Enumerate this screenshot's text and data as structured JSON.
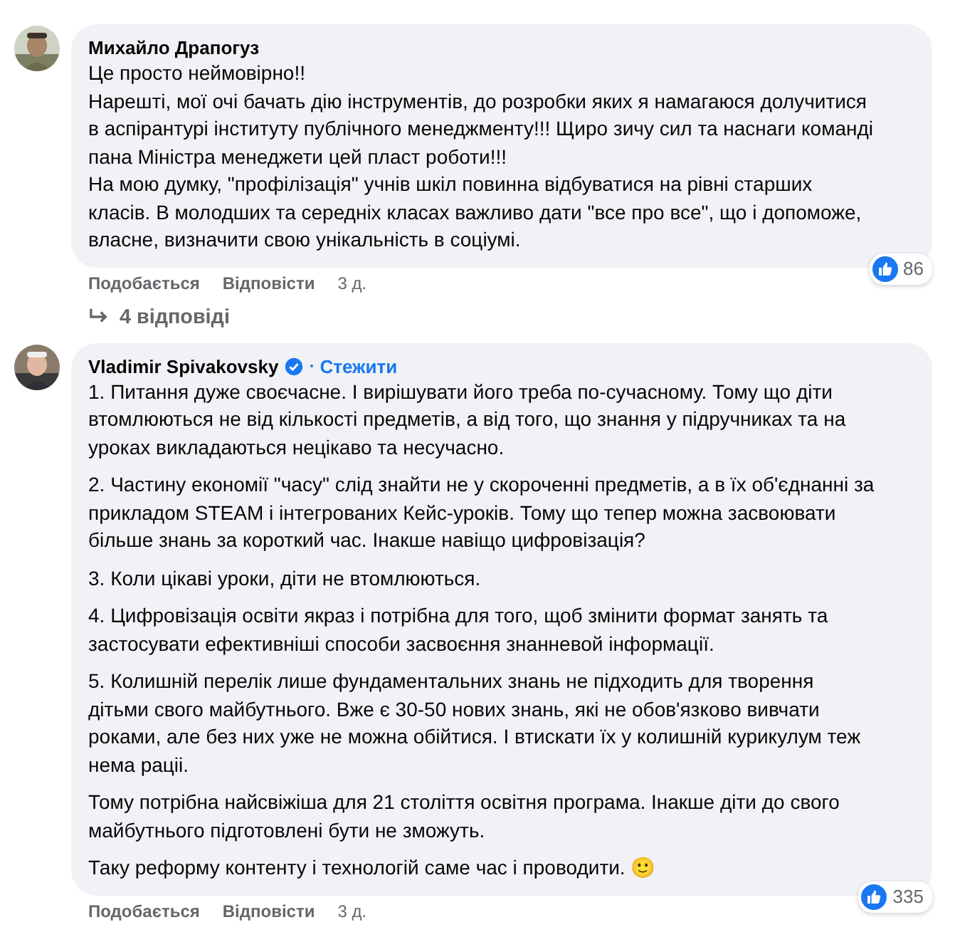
{
  "comments": [
    {
      "author": "Михайло Драпогуз",
      "verified": false,
      "spaced": false,
      "paragraphs": [
        "Це просто неймовірно!!",
        "Нарешті, мої очі бачать дію інструментів, до розробки яких я намагаюся долучитися в аспірантурі інституту публічного менеджменту!!! Щиро зичу сил та наснаги команді пана Міністра менеджети цей пласт роботи!!!",
        "На мою думку, \"профілізація\" учнів шкіл повинна відбуватися на рівні старших класів. В молодших та середніх класах важливо дати \"все про все\", що і допоможе, власне, визначити свою унікальність в соціумі."
      ],
      "reactions": "86",
      "actions": [
        "Подобається",
        "Відповісти"
      ],
      "time": "3 д.",
      "replies": "4 відповіді"
    },
    {
      "author": "Vladimir Spivakovsky",
      "verified": true,
      "follow": "Стежити",
      "spaced": true,
      "paragraphs": [
        "1. Питання дуже своєчасне. І вирішувати його треба по-сучасному. Тому що діти втомлюються не від кількості предметів, а від того, що знання у підручниках та на уроках викладаються нецікаво та несучасно.",
        "2. Частину економії \"часу\" слід знайти не у скороченні предметів, а в їх об'єднанні за прикладом STEAM і інтегрованих Кейс-уроків. Тому що тепер можна засвоювати більше знань за короткий час. Інакше навіщо цифровізація?",
        "3. Коли цікаві уроки, діти не втомлюються.",
        "4. Цифровізація освіти якраз і потрібна для того, щоб змінити формат занять та застосувати ефективніші способи засвоєння знанневой інформації.",
        "5. Колишній перелік лише фундаментальних знань не підходить для творення дітьми свого майбутнього. Вже є 30-50 нових знань, які не обов'язково вивчати роками, але без них уже не можна обійтися. І втискати їх у колишній курикулум теж нема раціі.",
        "Тому потрібна найсвіжіша для 21 століття освітня програма. Інакше діти до свого майбутнього підготовлені бути не зможуть.",
        "Таку реформу контенту і технологій саме час і проводити. 🙂"
      ],
      "reactions": "335",
      "actions": [
        "Подобається",
        "Відповісти"
      ],
      "time": "3 д."
    }
  ]
}
